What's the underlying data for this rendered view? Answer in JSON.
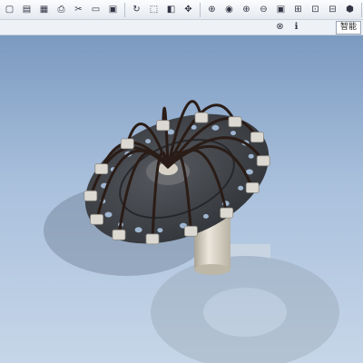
{
  "toolbar": {
    "icons": [
      "new-icon",
      "open-icon",
      "save-icon",
      "print-icon",
      "cut-icon",
      "copy-icon",
      "paste-icon",
      "regenerate-icon",
      "select-icon",
      "repaint-icon",
      "spin-center-icon",
      "orient-icon",
      "view-manager-icon",
      "zoom-in-icon",
      "zoom-out-icon",
      "refit-icon",
      "reorient-icon",
      "saved-views-icon",
      "layers-icon",
      "appearance-icon",
      "wireframe-icon",
      "hidden-line-icon",
      "no-hidden-icon",
      "shading-icon",
      "datum-icon"
    ],
    "glyphs": [
      "▢",
      "▤",
      "▦",
      "⎙",
      "✂",
      "▭",
      "▣",
      "↻",
      "⬚",
      "◧",
      "✥",
      "⊕",
      "◉",
      "⊕",
      "⊖",
      "▣",
      "⊞",
      "⊡",
      "⊟",
      "⬢",
      "▢",
      "▢",
      "▢",
      "◼",
      "↗"
    ],
    "active_index": 22
  },
  "subbar": {
    "button_label": "智能",
    "icons": [
      "close-icon",
      "info-icon"
    ],
    "glyphs": [
      "⊗",
      "ℹ"
    ]
  },
  "colors": {
    "sky_top": "#7b9ac0",
    "sky_bottom": "#c6d6e8",
    "disk": "#3f4247",
    "shaft": "#d8d2c6",
    "clip": "#dcd9d2",
    "hose": "#2a1c16"
  }
}
